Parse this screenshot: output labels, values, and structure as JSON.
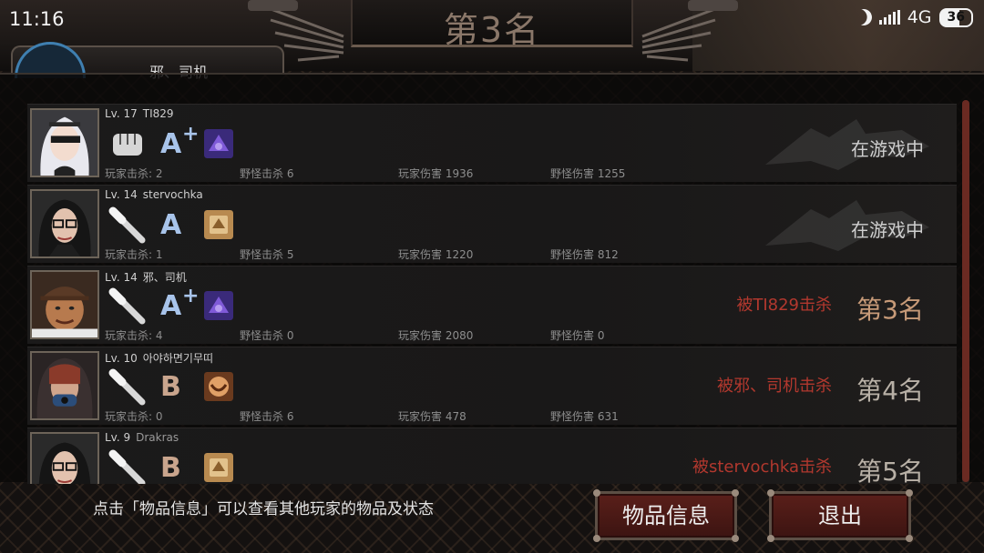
{
  "status_bar": {
    "time": "11:16",
    "network": "4G",
    "battery": "36"
  },
  "header": {
    "title": "第3名",
    "player_tab_name": "邪、司机"
  },
  "players": [
    {
      "level": "Lv. 17",
      "name": "TI829",
      "name_dim": false,
      "grade": "A",
      "grade_plus": "+",
      "grade_color": "blue",
      "weapon": "fist-icon",
      "item": "purple-item-icon",
      "stats": {
        "player_kills": "玩家击杀: 2",
        "monster_kills": "野怪击杀 6",
        "player_damage": "玩家伤害 1936",
        "monster_damage": "野怪伤害 1255"
      },
      "killed_by": "",
      "status": "在游戏中",
      "status_type": "live",
      "avatar": "white-hair-eyepatch-avatar"
    },
    {
      "level": "Lv. 14",
      "name": "stervochka",
      "name_dim": false,
      "grade": "A",
      "grade_plus": "",
      "grade_color": "blue",
      "weapon": "bat-icon",
      "item": "tan-item-icon",
      "stats": {
        "player_kills": "玩家击杀: 1",
        "monster_kills": "野怪击杀 5",
        "player_damage": "玩家伤害 1220",
        "monster_damage": "野怪伤害 812"
      },
      "killed_by": "",
      "status": "在游戏中",
      "status_type": "live",
      "avatar": "glasses-woman-avatar"
    },
    {
      "level": "Lv. 14",
      "name": "邪、司机",
      "name_dim": false,
      "grade": "A",
      "grade_plus": "+",
      "grade_color": "blue",
      "weapon": "bat-icon",
      "item": "purple-item-icon",
      "stats": {
        "player_kills": "玩家击杀: 4",
        "monster_kills": "野怪击杀 0",
        "player_damage": "玩家伤害 2080",
        "monster_damage": "野怪伤害 0"
      },
      "killed_by": "被TI829击杀",
      "status": "第3名",
      "status_type": "rank3",
      "avatar": "cap-man-avatar"
    },
    {
      "level": "Lv. 10",
      "name": "아야하면기무띠",
      "name_dim": false,
      "grade": "B",
      "grade_plus": "",
      "grade_color": "tan",
      "weapon": "bat-icon",
      "item": "orange-item-icon",
      "stats": {
        "player_kills": "玩家击杀: 0",
        "monster_kills": "野怪击杀 6",
        "player_damage": "玩家伤害 478",
        "monster_damage": "野怪伤害 631"
      },
      "killed_by": "被邪、司机击杀",
      "status": "第4名",
      "status_type": "rank",
      "avatar": "hooded-mask-avatar"
    },
    {
      "level": "Lv. 9",
      "name": "Drakras",
      "name_dim": true,
      "grade": "B",
      "grade_plus": "",
      "grade_color": "tan",
      "weapon": "bat-icon",
      "item": "tan-item-icon",
      "stats": {
        "player_kills": "",
        "monster_kills": "",
        "player_damage": "",
        "monster_damage": ""
      },
      "killed_by": "被stervochka击杀",
      "status": "第5名",
      "status_type": "rank",
      "avatar": "glasses-woman-avatar"
    }
  ],
  "footer": {
    "hint": "点击「物品信息」可以查看其他玩家的物品及状态",
    "items_button": "物品信息",
    "quit_button": "退出"
  },
  "colors": {
    "killed_text": "#b2382e",
    "rank3_text": "#c79a78",
    "button_red": "#5a1f1a",
    "grade_blue": "#a8c4ea",
    "grade_tan": "#c9a58d"
  }
}
